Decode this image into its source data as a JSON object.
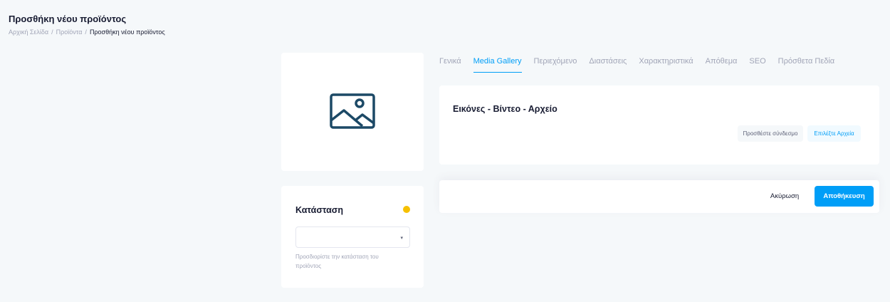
{
  "header": {
    "title": "Προσθήκη νέου προϊόντος",
    "breadcrumb": {
      "home": "Αρχική Σελίδα",
      "products": "Προϊόντα",
      "current": "Προσθήκη νέου προϊόντος",
      "separator": "/"
    }
  },
  "thumbnail": {
    "icon": "image-placeholder-icon"
  },
  "status": {
    "title": "Κατάσταση",
    "indicator_color": "#f6c000",
    "selected_value": "",
    "caret": "▾",
    "help_text": "Προσδιορίστε την κατάσταση του προϊόντος"
  },
  "tabs": [
    {
      "label": "Γενικά",
      "active": false
    },
    {
      "label": "Media Gallery",
      "active": true
    },
    {
      "label": "Περιεχόμενο",
      "active": false
    },
    {
      "label": "Διαστάσεις",
      "active": false
    },
    {
      "label": "Χαρακτηριστικά",
      "active": false
    },
    {
      "label": "Απόθεμα",
      "active": false
    },
    {
      "label": "SEO",
      "active": false
    },
    {
      "label": "Πρόσθετα Πεδία",
      "active": false
    }
  ],
  "media": {
    "title": "Εικόνες - Βίντεο - Αρχείο",
    "add_link_label": "Προσθέστε σύνδεσμο",
    "choose_files_label": "Επιλέξτε Αρχεία"
  },
  "actions": {
    "cancel_label": "Ακύρωση",
    "save_label": "Αποθήκευση"
  },
  "colors": {
    "accent": "#009ef7",
    "background": "#f5f8fa",
    "icon": "#1c4966"
  }
}
